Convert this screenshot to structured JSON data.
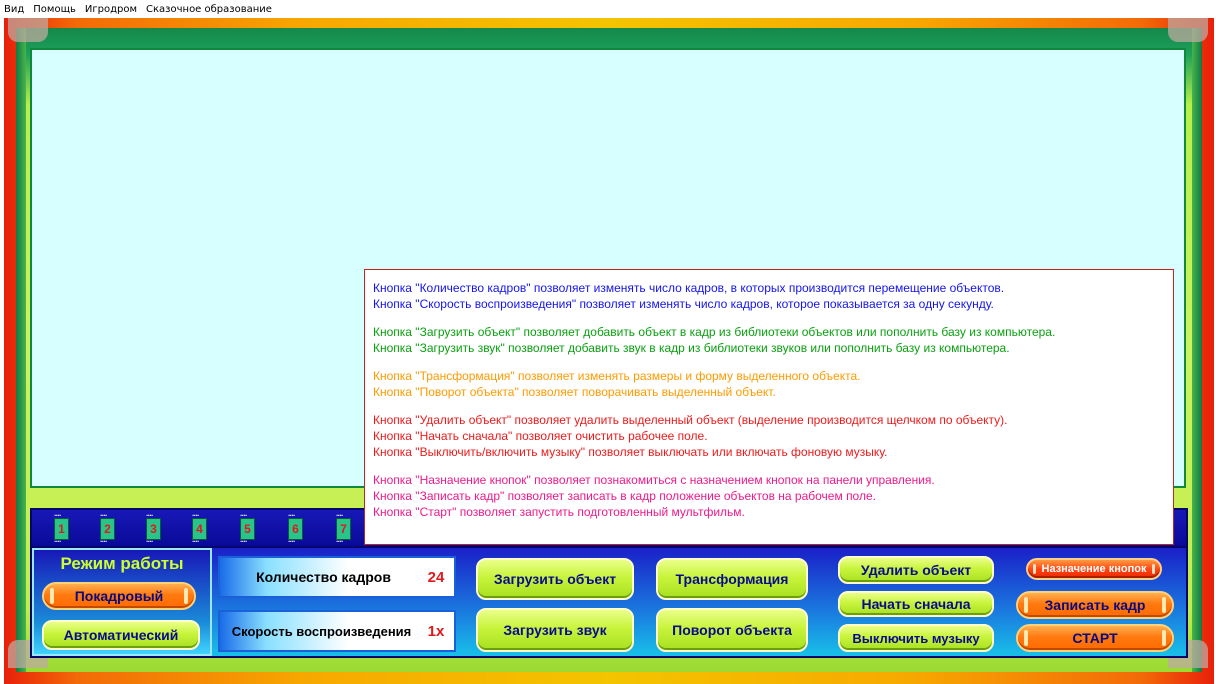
{
  "menu": {
    "items": [
      "Вид",
      "Помощь",
      "Игродром",
      "Сказочное образование"
    ]
  },
  "frames": [
    "1",
    "2",
    "3",
    "4",
    "5",
    "6",
    "7"
  ],
  "mode": {
    "title": "Режим работы",
    "frame_by_frame": "Покадровый",
    "automatic": "Автоматический"
  },
  "counters": {
    "frames_label": "Количество кадров",
    "frames_value": "24",
    "speed_label": "Скорость воспроизведения",
    "speed_value": "1x"
  },
  "buttons": {
    "load_object": "Загрузить объект",
    "load_sound": "Загрузить звук",
    "transform": "Трансформация",
    "rotate": "Поворот объекта",
    "delete_object": "Удалить объект",
    "start_over": "Начать сначала",
    "toggle_music": "Выключить музыку",
    "button_help": "Назначение кнопок",
    "record_frame": "Записать кадр",
    "start": "СТАРТ"
  },
  "help": {
    "blue": [
      "Кнопка \"Количество кадров\" позволяет изменять число кадров, в которых производится перемещение объектов.",
      "Кнопка \"Скорость воспроизведения\" позволяет изменять число кадров, которое показывается за одну секунду."
    ],
    "green": [
      "Кнопка \"Загрузить объект\" позволяет добавить объект в кадр из библиотеки объектов или пополнить базу из компьютера.",
      "Кнопка \"Загрузить звук\" позволяет добавить звук в кадр из библиотеки звуков или пополнить базу из компьютера."
    ],
    "orange": [
      "Кнопка \"Трансформация\" позволяет изменять размеры и форму выделенного объекта.",
      "Кнопка \"Поворот объекта\" позволяет поворачивать выделенный объект."
    ],
    "red": [
      "Кнопка \"Удалить объект\" позволяет удалить выделенный объект (выделение производится щелчком по объекту).",
      "Кнопка \"Начать сначала\" позволяет очистить рабочее поле.",
      "Кнопка \"Выключить/включить музыку\" позволяет выключать или включать фоновую музыку."
    ],
    "pink": [
      "Кнопка \"Назначение кнопок\" позволяет познакомиться с назначением кнопок на панели управления.",
      "Кнопка \"Записать кадр\" позволяет записать в кадр положение объектов на рабочем поле.",
      "Кнопка \"Старт\" позволяет запустить подготовленный мультфильм."
    ]
  },
  "colors": {
    "help_blue": "#1414ee",
    "help_green": "#0aa010",
    "help_orange": "#ff9a00",
    "help_red": "#ee1a1a",
    "help_pink": "#ee1a8a",
    "workarea": "#d8ffff"
  }
}
